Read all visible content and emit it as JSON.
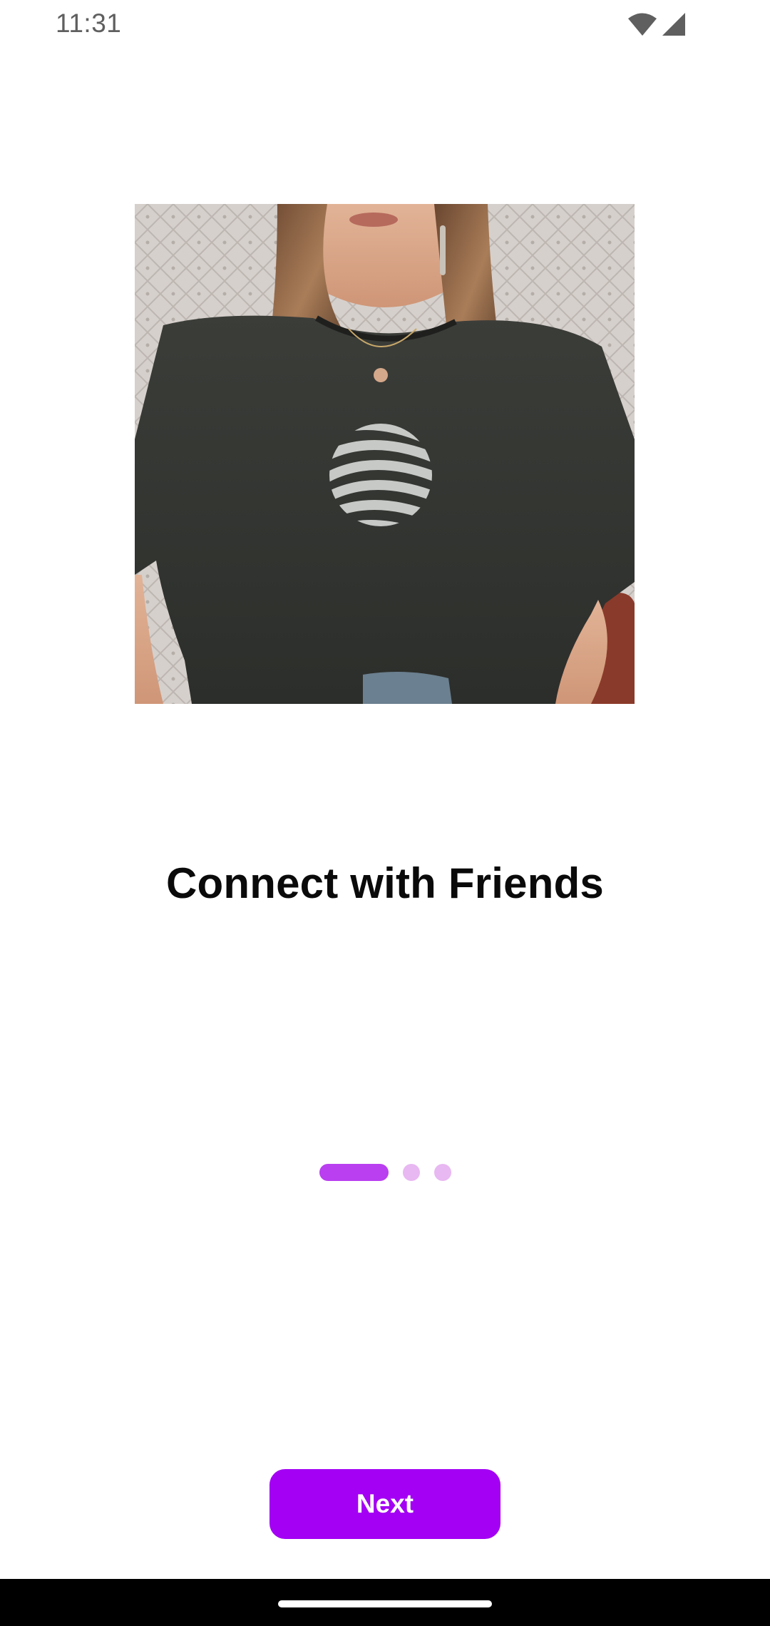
{
  "status_bar": {
    "time": "11:31",
    "icons": [
      "wifi-icon",
      "cellular-signal-icon"
    ]
  },
  "onboarding": {
    "hero_image": "woman-in-graphic-tshirt-photo",
    "title": "Connect with Friends",
    "pages_total": 3,
    "current_page": 1
  },
  "actions": {
    "next_label": "Next"
  },
  "colors": {
    "accent": "#a300f4",
    "indicator_active": "#b93ff0",
    "indicator_inactive": "#e8b8f2"
  }
}
